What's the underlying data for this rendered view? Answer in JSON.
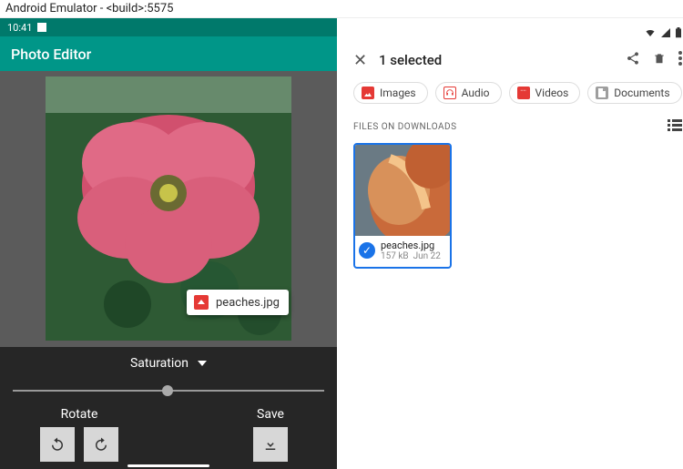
{
  "window_title": "Android Emulator - <build>:5575",
  "phone": {
    "status_time": "10:41",
    "app_title": "Photo Editor",
    "drag_chip_label": "peaches.jpg",
    "saturation_label": "Saturation",
    "slider_value_pct": 48,
    "rotate_label": "Rotate",
    "save_label": "Save"
  },
  "picker": {
    "selection_title": "1 selected",
    "chips": [
      {
        "label": "Images",
        "icon": "image"
      },
      {
        "label": "Audio",
        "icon": "audio"
      },
      {
        "label": "Videos",
        "icon": "video"
      },
      {
        "label": "Documents",
        "icon": "document"
      }
    ],
    "section_label": "FILES ON DOWNLOADS",
    "file": {
      "name": "peaches.jpg",
      "size": "157 kB",
      "date": "Jun 22",
      "selected": true
    }
  }
}
